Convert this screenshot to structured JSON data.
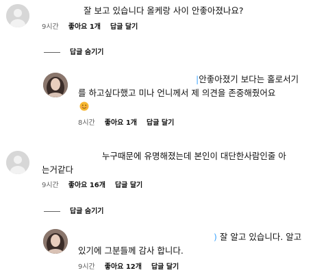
{
  "comments": [
    {
      "text_lines": [
        "잘 보고 있습니다 올케랑 사이 안좋아졌나요?"
      ],
      "time": "9시간",
      "likes": "좋아요 1개",
      "reply_label": "답글 달기",
      "hide_replies_label": "답글 숨기기",
      "reply": {
        "text_lines": [
          "안좋아졌기 보다는 홀로서기",
          "를 하고싶다했고 미나 언니께서 제 의견을 존중해줬어요"
        ],
        "emoji": "😊",
        "time": "8시간",
        "likes": "좋아요 1개",
        "reply_label": "답글 달기"
      }
    },
    {
      "text_lines": [
        "누구때문에 유명해졌는데 본인이 대단한사람인줄 아",
        "는거같다"
      ],
      "time": "9시간",
      "likes": "좋아요 16개",
      "reply_label": "답글 달기",
      "hide_replies_label": "답글 숨기기",
      "reply": {
        "prefix": ")",
        "text_lines": [
          "잘 알고 있습니다. 알고",
          "있기에 그분들께 감사 합니다."
        ],
        "time": "9시간",
        "likes": "좋아요 12개",
        "reply_label": "답글 달기"
      }
    }
  ]
}
